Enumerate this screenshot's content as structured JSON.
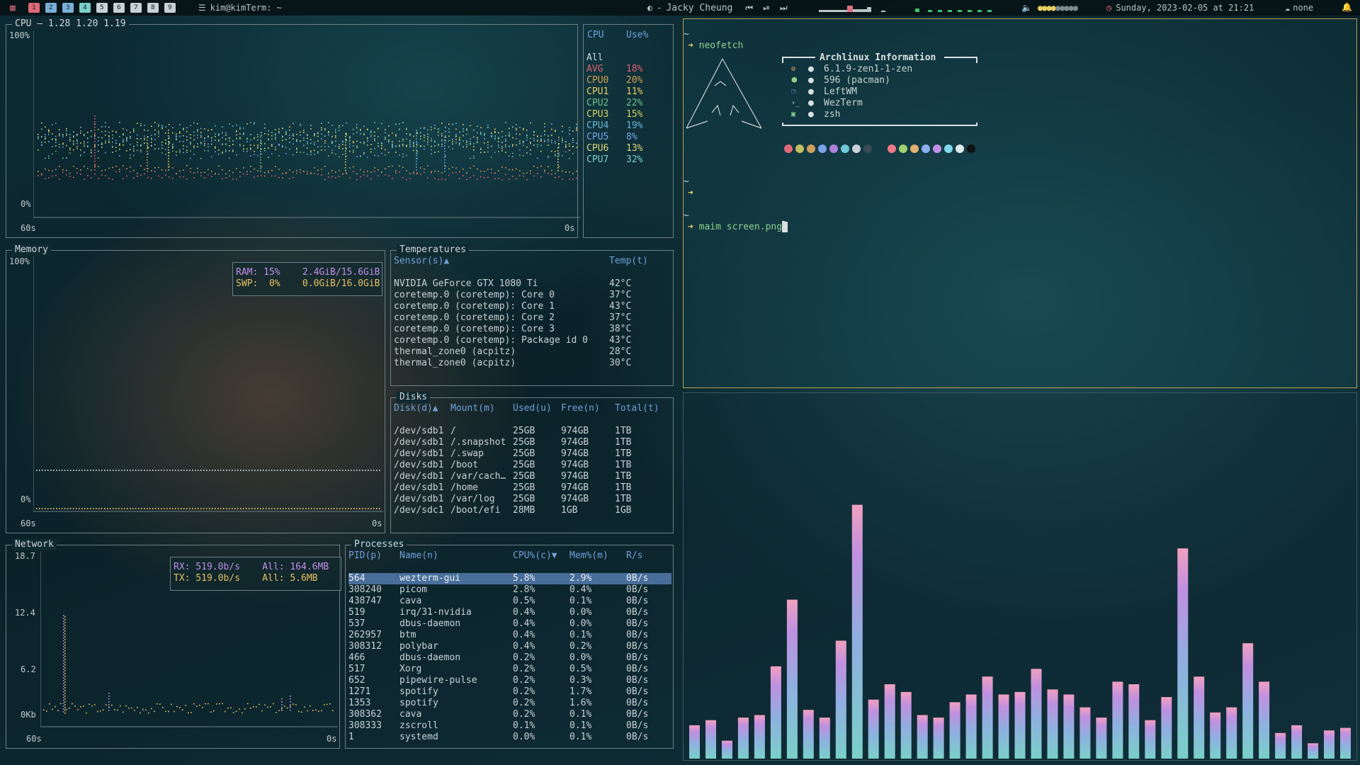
{
  "topbar": {
    "workspaces": [
      "1",
      "2",
      "3",
      "4",
      "5",
      "6",
      "7",
      "8",
      "9"
    ],
    "window_title": "kim@kimTerm: ~",
    "now_playing": "Jacky Cheung",
    "datetime": "Sunday, 2023-02-05 at 21:21",
    "network": "none"
  },
  "cpu": {
    "title": "CPU — 1.28 1.20 1.19",
    "y_top": "100%",
    "y_bottom": "0%",
    "x_left": "60s",
    "x_right": "0s",
    "table_header": [
      "CPU",
      "Use%"
    ],
    "rows": [
      {
        "name": "All",
        "val": ""
      },
      {
        "name": "AVG",
        "val": "18%"
      },
      {
        "name": "CPU0",
        "val": "20%"
      },
      {
        "name": "CPU1",
        "val": "11%"
      },
      {
        "name": "CPU2",
        "val": "22%"
      },
      {
        "name": "CPU3",
        "val": "15%"
      },
      {
        "name": "CPU4",
        "val": "19%"
      },
      {
        "name": "CPU5",
        "val": "8%"
      },
      {
        "name": "CPU6",
        "val": "13%"
      },
      {
        "name": "CPU7",
        "val": "32%"
      }
    ],
    "colors": [
      "#d0d8da",
      "#e06070",
      "#d7a050",
      "#e8d060",
      "#6fc08a",
      "#d8d060",
      "#68b8d8",
      "#7aa0e8",
      "#d8d880",
      "#7ad0c8"
    ]
  },
  "memory": {
    "title": "Memory",
    "y_top": "100%",
    "y_bottom": "0%",
    "x_left": "60s",
    "x_right": "0s",
    "ram": "RAM: 15%    2.4GiB/15.6GiB",
    "swp": "SWP:  0%    0.0GiB/16.0GiB"
  },
  "temps": {
    "title": "Temperatures",
    "header_sensor": "Sensor(s)▲",
    "header_temp": "Temp(t)",
    "rows": [
      {
        "s": "NVIDIA GeForce GTX 1080 Ti",
        "t": "42°C"
      },
      {
        "s": "coretemp.0 (coretemp): Core 0",
        "t": "37°C"
      },
      {
        "s": "coretemp.0 (coretemp): Core 1",
        "t": "43°C"
      },
      {
        "s": "coretemp.0 (coretemp): Core 2",
        "t": "37°C"
      },
      {
        "s": "coretemp.0 (coretemp): Core 3",
        "t": "38°C"
      },
      {
        "s": "coretemp.0 (coretemp): Package id 0",
        "t": "43°C"
      },
      {
        "s": "thermal_zone0 (acpitz)",
        "t": "28°C"
      },
      {
        "s": "thermal_zone0 (acpitz)",
        "t": "30°C"
      }
    ]
  },
  "disks": {
    "title": "Disks",
    "headers": [
      "Disk(d)▲",
      "Mount(m)",
      "Used(u)",
      "Free(n)",
      "Total(t)"
    ],
    "rows": [
      [
        "/dev/sdb1",
        "/",
        "25GB",
        "974GB",
        "1TB"
      ],
      [
        "/dev/sdb1",
        "/.snapshot",
        "25GB",
        "974GB",
        "1TB"
      ],
      [
        "/dev/sdb1",
        "/.swap",
        "25GB",
        "974GB",
        "1TB"
      ],
      [
        "/dev/sdb1",
        "/boot",
        "25GB",
        "974GB",
        "1TB"
      ],
      [
        "/dev/sdb1",
        "/var/cach…",
        "25GB",
        "974GB",
        "1TB"
      ],
      [
        "/dev/sdb1",
        "/home",
        "25GB",
        "974GB",
        "1TB"
      ],
      [
        "/dev/sdb1",
        "/var/log",
        "25GB",
        "974GB",
        "1TB"
      ],
      [
        "/dev/sdc1",
        "/boot/efi",
        "28MB",
        "1GB",
        "1GB"
      ]
    ]
  },
  "network": {
    "title": "Network",
    "y_labels": [
      "18.7",
      "12.4",
      "6.2",
      "0Kb"
    ],
    "x_left": "60s",
    "x_right": "0s",
    "rx": "RX: 519.0b/s    All: 164.6MB",
    "tx": "TX: 519.0b/s    All: 5.6MB"
  },
  "processes": {
    "title": "Processes",
    "headers": [
      "PID(p)",
      "Name(n)",
      "CPU%(c)▼",
      "Mem%(m)",
      "R/s"
    ],
    "rows": [
      [
        "564",
        "wezterm-gui",
        "5.8%",
        "2.9%",
        "0B/s"
      ],
      [
        "308240",
        "picom",
        "2.8%",
        "0.4%",
        "0B/s"
      ],
      [
        "438747",
        "cava",
        "0.5%",
        "0.1%",
        "0B/s"
      ],
      [
        "519",
        "irq/31-nvidia",
        "0.4%",
        "0.0%",
        "0B/s"
      ],
      [
        "537",
        "dbus-daemon",
        "0.4%",
        "0.0%",
        "0B/s"
      ],
      [
        "262957",
        "btm",
        "0.4%",
        "0.1%",
        "0B/s"
      ],
      [
        "308312",
        "polybar",
        "0.4%",
        "0.2%",
        "0B/s"
      ],
      [
        "466",
        "dbus-daemon",
        "0.2%",
        "0.0%",
        "0B/s"
      ],
      [
        "517",
        "Xorg",
        "0.2%",
        "0.5%",
        "0B/s"
      ],
      [
        "652",
        "pipewire-pulse",
        "0.2%",
        "0.3%",
        "0B/s"
      ],
      [
        "1271",
        "spotify",
        "0.2%",
        "1.7%",
        "0B/s"
      ],
      [
        "1353",
        "spotify",
        "0.2%",
        "1.6%",
        "0B/s"
      ],
      [
        "308362",
        "cava",
        "0.2%",
        "0.1%",
        "0B/s"
      ],
      [
        "308333",
        "zscroll",
        "0.1%",
        "0.1%",
        "0B/s"
      ],
      [
        "1",
        "systemd",
        "0.0%",
        "0.1%",
        "0B/s"
      ]
    ]
  },
  "terminal": {
    "tilde1": "~",
    "cmd1": "neofetch",
    "info_title": "Archlinux Information",
    "info": [
      "6.1.9-zen1-1-zen",
      "596 (pacman)",
      "LeftWM",
      "WezTerm",
      "zsh"
    ],
    "tilde2": "~",
    "tilde3": "~",
    "cmd2": "maim screen.png",
    "palette1": [
      "#e06a7a",
      "#c0c060",
      "#d0a060",
      "#7aa0e8",
      "#b080d8",
      "#70c8d8",
      "#c8d0d8",
      "#3a4a58"
    ],
    "palette2": [
      "#f07a8a",
      "#a0d070",
      "#e0b070",
      "#8ab0f0",
      "#c090e8",
      "#80d8e8",
      "#e0e8f0",
      "#101010"
    ]
  },
  "cava": {
    "bar_colors": [
      "#7ad0c8",
      "#8fb0e0",
      "#c090e0",
      "#f0a0c0"
    ]
  },
  "chart_data": [
    {
      "type": "bar",
      "values": [
        0.13,
        0.15,
        0.07,
        0.16,
        0.17,
        0.36,
        0.62,
        0.19,
        0.16,
        0.46,
        0.99,
        0.23,
        0.29,
        0.26,
        0.17,
        0.16,
        0.22,
        0.25,
        0.32,
        0.25,
        0.26,
        0.35,
        0.27,
        0.25,
        0.2,
        0.16,
        0.3,
        0.29,
        0.15,
        0.24,
        0.82,
        0.32,
        0.18,
        0.2,
        0.45,
        0.3,
        0.1,
        0.13,
        0.06,
        0.11,
        0.12
      ]
    }
  ]
}
